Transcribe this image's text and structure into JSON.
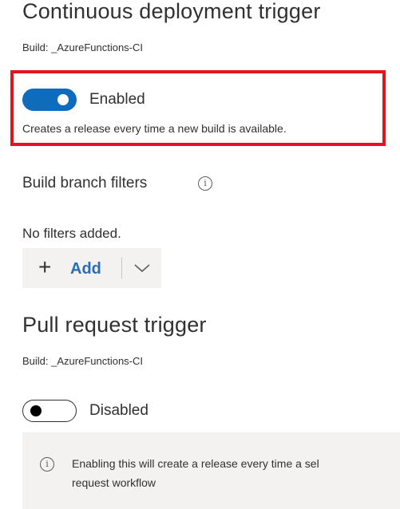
{
  "cd_trigger": {
    "title": "Continuous deployment trigger",
    "build_label": "Build: _AzureFunctions-CI",
    "toggle_state": "on",
    "toggle_label": "Enabled",
    "description": "Creates a release every time a new build is available."
  },
  "branch_filters": {
    "title": "Build branch filters",
    "info_icon": "info-icon",
    "empty_text": "No filters added.",
    "add_label": "Add",
    "add_icon": "plus-icon",
    "dropdown_icon": "chevron-down-icon"
  },
  "pr_trigger": {
    "title": "Pull request trigger",
    "build_label": "Build: _AzureFunctions-CI",
    "toggle_state": "off",
    "toggle_label": "Disabled",
    "info_line1": "Enabling this will create a release every time a sel",
    "info_line2": "request workflow"
  },
  "colors": {
    "accent": "#0f6cbd",
    "link": "#2b6cb6",
    "highlight": "#e3141d",
    "panel_bg": "#f3f2f1"
  }
}
